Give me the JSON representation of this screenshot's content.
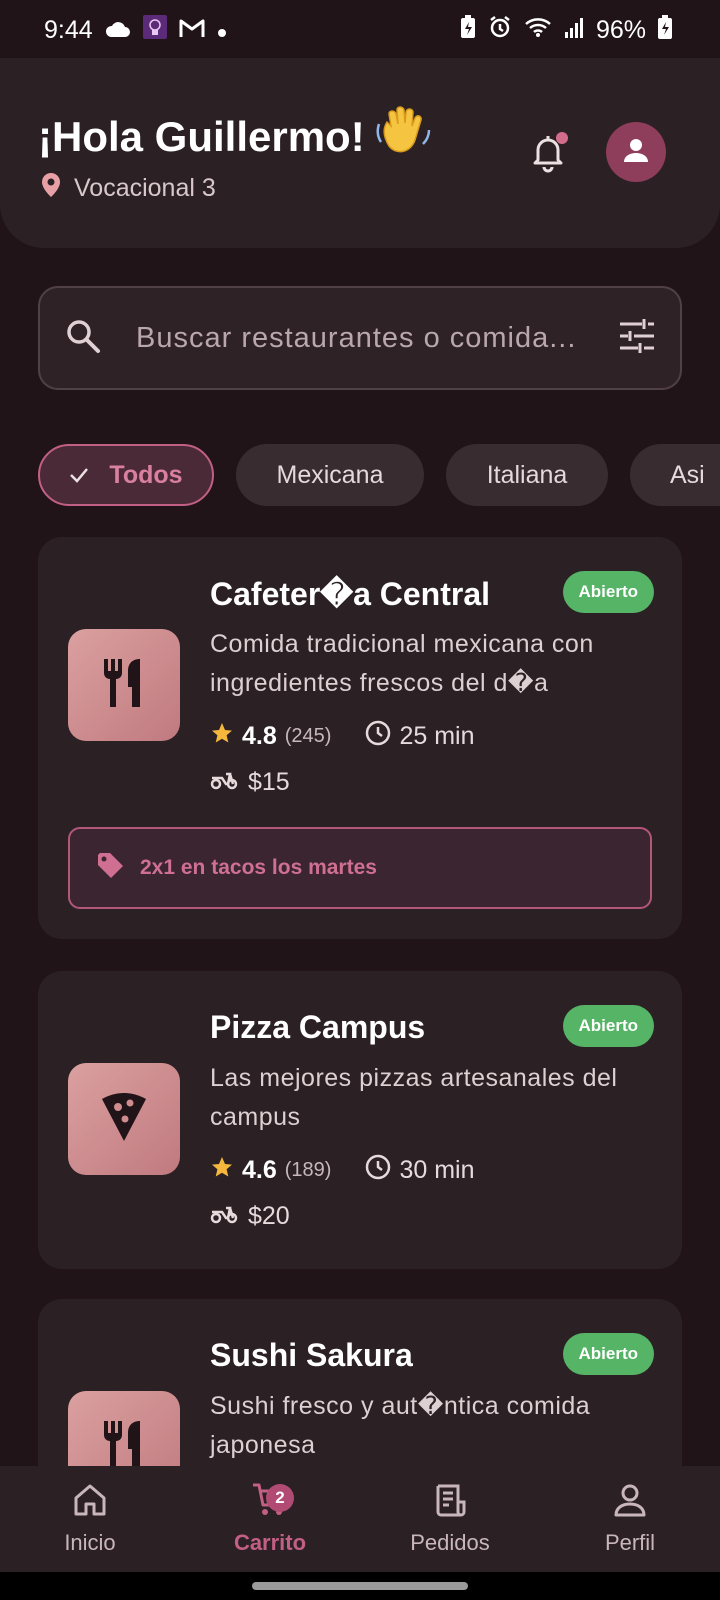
{
  "status_bar": {
    "time": "9:44",
    "battery": "96%",
    "icons_left": [
      "cloud-icon",
      "app-icon",
      "gmail-icon",
      "dot-icon"
    ],
    "icons_right": [
      "battery-saver-icon",
      "alarm-icon",
      "wifi-icon",
      "signal-icon",
      "battery-icon"
    ]
  },
  "header": {
    "greeting": "¡Hola Guillermo!",
    "wave_emoji": "👋",
    "location": "Vocacional 3",
    "has_notification": true
  },
  "search": {
    "placeholder": "Buscar restaurantes o comida..."
  },
  "chips": [
    {
      "label": "Todos",
      "selected": true
    },
    {
      "label": "Mexicana",
      "selected": false
    },
    {
      "label": "Italiana",
      "selected": false
    },
    {
      "label": "Asi",
      "selected": false
    }
  ],
  "restaurants": [
    {
      "name": "Cafeter�a Central",
      "status": "Abierto",
      "description": "Comida tradicional mexicana con ingredientes frescos del d�a",
      "rating": "4.8",
      "reviews": "(245)",
      "time": "25 min",
      "delivery_fee": "$15",
      "promo": "2x1 en tacos los martes",
      "icon": "utensils-icon"
    },
    {
      "name": "Pizza Campus",
      "status": "Abierto",
      "description": "Las mejores pizzas artesanales del campus",
      "rating": "4.6",
      "reviews": "(189)",
      "time": "30 min",
      "delivery_fee": "$20",
      "icon": "pizza-icon"
    },
    {
      "name": "Sushi Sakura",
      "status": "Abierto",
      "description": "Sushi fresco y aut�ntica comida japonesa",
      "icon": "utensils-icon"
    }
  ],
  "bottom_nav": [
    {
      "label": "Inicio",
      "icon": "home-icon",
      "active": false
    },
    {
      "label": "Carrito",
      "icon": "cart-icon",
      "active": true,
      "badge": "2"
    },
    {
      "label": "Pedidos",
      "icon": "receipt-icon",
      "active": false
    },
    {
      "label": "Perfil",
      "icon": "person-icon",
      "active": false
    }
  ],
  "colors": {
    "background": "#211418",
    "surface": "#2b2024",
    "accent": "#c25f84",
    "open_badge": "#55b465",
    "icon_tile": "#cf8c8f"
  }
}
